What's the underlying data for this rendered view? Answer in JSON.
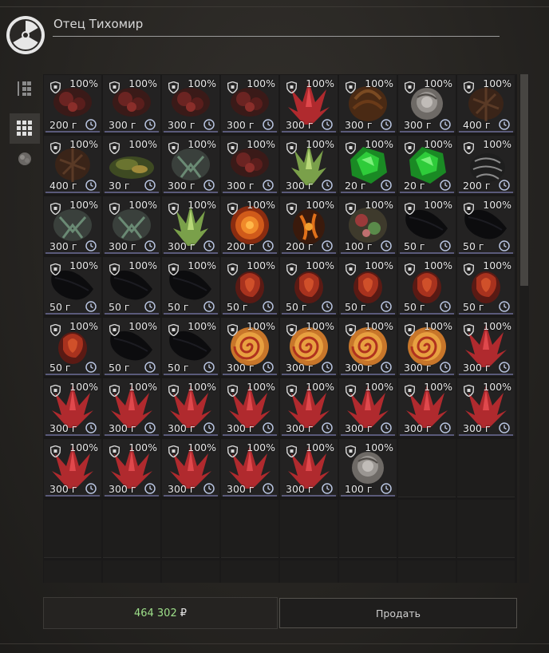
{
  "window": {
    "trader_name": "Отец Тихомир"
  },
  "side_tabs": [
    {
      "name": "sort-tab",
      "icon": "sort-list-icon"
    },
    {
      "name": "grid-tab",
      "icon": "grid-icon",
      "active": true
    },
    {
      "name": "artifact-tab",
      "icon": "artifact-icon"
    }
  ],
  "inventory": {
    "columns": 8,
    "items": [
      {
        "pct": "100%",
        "weight": "200 г",
        "art": "dark-red"
      },
      {
        "pct": "100%",
        "weight": "300 г",
        "art": "dark-red"
      },
      {
        "pct": "100%",
        "weight": "300 г",
        "art": "dark-red"
      },
      {
        "pct": "100%",
        "weight": "300 г",
        "art": "dark-red"
      },
      {
        "pct": "100%",
        "weight": "300 г",
        "art": "red-crystal"
      },
      {
        "pct": "100%",
        "weight": "300 г",
        "art": "brown-shell"
      },
      {
        "pct": "100%",
        "weight": "300 г",
        "art": "white-rose"
      },
      {
        "pct": "100%",
        "weight": "400 г",
        "art": "dark-brown"
      },
      {
        "pct": "100%",
        "weight": "400 г",
        "art": "dark-brown"
      },
      {
        "pct": "100%",
        "weight": "30 г",
        "art": "green-moss"
      },
      {
        "pct": "100%",
        "weight": "300 г",
        "art": "grey-green"
      },
      {
        "pct": "100%",
        "weight": "300 г",
        "art": "dark-red"
      },
      {
        "pct": "100%",
        "weight": "300 г",
        "art": "green-crystal"
      },
      {
        "pct": "100%",
        "weight": "20 г",
        "art": "emerald"
      },
      {
        "pct": "100%",
        "weight": "20 г",
        "art": "emerald"
      },
      {
        "pct": "100%",
        "weight": "200 г",
        "art": "dark-stripes"
      },
      {
        "pct": "100%",
        "weight": "300 г",
        "art": "grey-green"
      },
      {
        "pct": "100%",
        "weight": "300 г",
        "art": "grey-green"
      },
      {
        "pct": "100%",
        "weight": "300 г",
        "art": "green-crystal"
      },
      {
        "pct": "100%",
        "weight": "200 г",
        "art": "fireball"
      },
      {
        "pct": "100%",
        "weight": "200 г",
        "art": "lava"
      },
      {
        "pct": "100%",
        "weight": "100 г",
        "art": "flesh-green"
      },
      {
        "pct": "100%",
        "weight": "50 г",
        "art": "black-leaf"
      },
      {
        "pct": "100%",
        "weight": "50 г",
        "art": "black-leaf"
      },
      {
        "pct": "100%",
        "weight": "50 г",
        "art": "black-leaf"
      },
      {
        "pct": "100%",
        "weight": "50 г",
        "art": "black-leaf"
      },
      {
        "pct": "100%",
        "weight": "50 г",
        "art": "black-leaf"
      },
      {
        "pct": "100%",
        "weight": "50 г",
        "art": "red-flower"
      },
      {
        "pct": "100%",
        "weight": "50 г",
        "art": "red-flower"
      },
      {
        "pct": "100%",
        "weight": "50 г",
        "art": "red-flower"
      },
      {
        "pct": "100%",
        "weight": "50 г",
        "art": "red-flower"
      },
      {
        "pct": "100%",
        "weight": "50 г",
        "art": "red-flower"
      },
      {
        "pct": "100%",
        "weight": "50 г",
        "art": "red-flower"
      },
      {
        "pct": "100%",
        "weight": "50 г",
        "art": "black-leaf"
      },
      {
        "pct": "100%",
        "weight": "50 г",
        "art": "black-leaf"
      },
      {
        "pct": "100%",
        "weight": "300 г",
        "art": "spiral"
      },
      {
        "pct": "100%",
        "weight": "300 г",
        "art": "spiral"
      },
      {
        "pct": "100%",
        "weight": "300 г",
        "art": "spiral"
      },
      {
        "pct": "100%",
        "weight": "300 г",
        "art": "spiral"
      },
      {
        "pct": "100%",
        "weight": "300 г",
        "art": "red-crystal"
      },
      {
        "pct": "100%",
        "weight": "300 г",
        "art": "red-crystal"
      },
      {
        "pct": "100%",
        "weight": "300 г",
        "art": "red-crystal"
      },
      {
        "pct": "100%",
        "weight": "300 г",
        "art": "red-crystal"
      },
      {
        "pct": "100%",
        "weight": "300 г",
        "art": "red-crystal"
      },
      {
        "pct": "100%",
        "weight": "300 г",
        "art": "red-crystal"
      },
      {
        "pct": "100%",
        "weight": "300 г",
        "art": "red-crystal"
      },
      {
        "pct": "100%",
        "weight": "300 г",
        "art": "red-crystal"
      },
      {
        "pct": "100%",
        "weight": "300 г",
        "art": "red-crystal"
      },
      {
        "pct": "100%",
        "weight": "300 г",
        "art": "red-crystal"
      },
      {
        "pct": "100%",
        "weight": "300 г",
        "art": "red-crystal"
      },
      {
        "pct": "100%",
        "weight": "300 г",
        "art": "red-crystal"
      },
      {
        "pct": "100%",
        "weight": "300 г",
        "art": "red-crystal"
      },
      {
        "pct": "100%",
        "weight": "300 г",
        "art": "red-crystal"
      },
      {
        "pct": "100%",
        "weight": "100 г",
        "art": "white-rose"
      }
    ],
    "empty_slots": 18
  },
  "footer": {
    "money_value": "464 302",
    "currency": "₽",
    "sell_label": "Продать"
  },
  "colors": {
    "money": "#9ee08a",
    "background": "#242220"
  }
}
